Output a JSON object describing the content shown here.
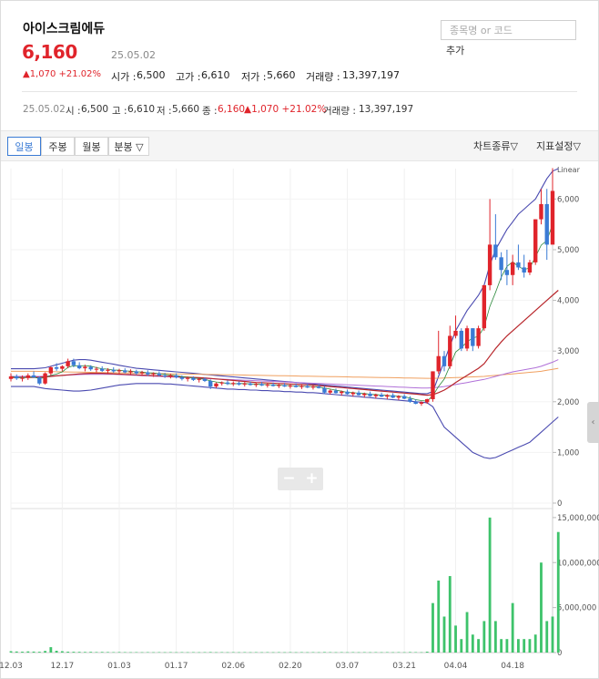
{
  "header": {
    "title": "아이스크림에듀",
    "price": "6,160",
    "date": "25.05.02",
    "change": "▲1,070 +21.02%",
    "open_label": "시가 :",
    "open": "6,500",
    "high_label": "고가 :",
    "high": "6,610",
    "low_label": "저가 :",
    "low": "5,660",
    "vol_label": "거래량 :",
    "volume": "13,397,197",
    "search_placeholder": "종목명 or 코드",
    "add_label": "추가"
  },
  "summary": {
    "date": "25.05.02",
    "open_label": "시 :",
    "open": "6,500",
    "high_label": "고 :",
    "high": "6,610",
    "low_label": "저 :",
    "low": "5,660",
    "close_label": "종 :",
    "close": "6,160",
    "change": "▲1,070 +21.02%",
    "vol_label": "거래량 :",
    "volume": "13,397,197"
  },
  "toolbar": {
    "tabs": [
      "일봉",
      "주봉",
      "월봉",
      "분봉 ▽"
    ],
    "chart_type": "차트종류▽",
    "indicator": "지표설정▽"
  },
  "colors": {
    "up": "#e0242b",
    "down": "#3a7bd5",
    "volume": "#3ec36b",
    "bollinger": "#4a4ab0",
    "ma20": "#b8262b",
    "ma60": "#b070d8",
    "ma120": "#f0a060",
    "ma5": "#2c8a3c"
  },
  "chart_data": {
    "type": "candlestick",
    "scale_label": "Linear",
    "x_ticks": [
      "12.03",
      "12.17",
      "01.03",
      "01.17",
      "02.06",
      "02.20",
      "03.07",
      "03.21",
      "04.04",
      "04.18"
    ],
    "y_ticks": [
      0,
      1000,
      2000,
      3000,
      4000,
      5000,
      6000
    ],
    "y_range": [
      0,
      6600
    ],
    "volume_ticks": [
      0,
      5000000,
      10000000,
      15000000
    ],
    "volume_tick_labels": [
      "0",
      "5,000,000",
      "10,000,000",
      "15,000,000"
    ],
    "volume_range": [
      0,
      16000000
    ],
    "candles": [
      [
        2450,
        2560,
        2400,
        2500
      ],
      [
        2500,
        2540,
        2430,
        2460
      ],
      [
        2460,
        2520,
        2400,
        2470
      ],
      [
        2470,
        2560,
        2430,
        2520
      ],
      [
        2520,
        2600,
        2470,
        2480
      ],
      [
        2480,
        2500,
        2330,
        2360
      ],
      [
        2360,
        2580,
        2340,
        2560
      ],
      [
        2560,
        2700,
        2520,
        2680
      ],
      [
        2680,
        2760,
        2610,
        2650
      ],
      [
        2650,
        2720,
        2600,
        2700
      ],
      [
        2700,
        2850,
        2660,
        2800
      ],
      [
        2800,
        2850,
        2680,
        2720
      ],
      [
        2720,
        2780,
        2640,
        2660
      ],
      [
        2660,
        2730,
        2600,
        2690
      ],
      [
        2690,
        2720,
        2610,
        2640
      ],
      [
        2640,
        2690,
        2580,
        2650
      ],
      [
        2650,
        2700,
        2590,
        2610
      ],
      [
        2610,
        2660,
        2560,
        2630
      ],
      [
        2630,
        2680,
        2570,
        2600
      ],
      [
        2600,
        2650,
        2550,
        2620
      ],
      [
        2620,
        2660,
        2560,
        2580
      ],
      [
        2580,
        2640,
        2540,
        2600
      ],
      [
        2600,
        2630,
        2530,
        2560
      ],
      [
        2560,
        2610,
        2510,
        2580
      ],
      [
        2580,
        2620,
        2510,
        2540
      ],
      [
        2540,
        2580,
        2490,
        2560
      ],
      [
        2560,
        2600,
        2500,
        2520
      ],
      [
        2520,
        2570,
        2470,
        2500
      ],
      [
        2500,
        2550,
        2460,
        2520
      ],
      [
        2520,
        2560,
        2460,
        2480
      ],
      [
        2480,
        2520,
        2420,
        2450
      ],
      [
        2450,
        2500,
        2400,
        2470
      ],
      [
        2470,
        2500,
        2410,
        2430
      ],
      [
        2430,
        2470,
        2380,
        2450
      ],
      [
        2450,
        2480,
        2390,
        2410
      ],
      [
        2410,
        2440,
        2250,
        2300
      ],
      [
        2300,
        2380,
        2270,
        2360
      ],
      [
        2360,
        2400,
        2320,
        2380
      ],
      [
        2380,
        2420,
        2330,
        2350
      ],
      [
        2350,
        2400,
        2310,
        2370
      ],
      [
        2370,
        2400,
        2320,
        2340
      ],
      [
        2340,
        2390,
        2300,
        2360
      ],
      [
        2360,
        2400,
        2320,
        2330
      ],
      [
        2330,
        2380,
        2290,
        2350
      ],
      [
        2350,
        2390,
        2310,
        2320
      ],
      [
        2320,
        2370,
        2280,
        2340
      ],
      [
        2340,
        2380,
        2300,
        2310
      ],
      [
        2310,
        2360,
        2270,
        2330
      ],
      [
        2330,
        2370,
        2290,
        2300
      ],
      [
        2300,
        2350,
        2260,
        2320
      ],
      [
        2320,
        2360,
        2280,
        2290
      ],
      [
        2290,
        2340,
        2250,
        2310
      ],
      [
        2310,
        2350,
        2270,
        2280
      ],
      [
        2280,
        2320,
        2240,
        2300
      ],
      [
        2300,
        2340,
        2260,
        2270
      ],
      [
        2270,
        2310,
        2150,
        2180
      ],
      [
        2180,
        2250,
        2140,
        2220
      ],
      [
        2220,
        2260,
        2160,
        2170
      ],
      [
        2170,
        2220,
        2120,
        2200
      ],
      [
        2200,
        2240,
        2140,
        2150
      ],
      [
        2150,
        2200,
        2100,
        2180
      ],
      [
        2180,
        2220,
        2120,
        2130
      ],
      [
        2130,
        2180,
        2080,
        2160
      ],
      [
        2160,
        2200,
        2100,
        2110
      ],
      [
        2110,
        2160,
        2060,
        2140
      ],
      [
        2140,
        2180,
        2090,
        2100
      ],
      [
        2100,
        2150,
        2050,
        2130
      ],
      [
        2130,
        2170,
        2070,
        2080
      ],
      [
        2080,
        2130,
        2030,
        2110
      ],
      [
        2110,
        2150,
        2050,
        2060
      ],
      [
        2060,
        2110,
        1980,
        2000
      ],
      [
        2000,
        2050,
        1950,
        1960
      ],
      [
        1960,
        2010,
        1920,
        1990
      ],
      [
        1990,
        2060,
        1960,
        2050
      ],
      [
        2050,
        2600,
        2000,
        2600
      ],
      [
        2600,
        3400,
        2550,
        2900
      ],
      [
        2900,
        3000,
        2600,
        2700
      ],
      [
        2700,
        3500,
        2650,
        3300
      ],
      [
        3300,
        3700,
        3250,
        3400
      ],
      [
        3400,
        3450,
        3000,
        3050
      ],
      [
        3050,
        3500,
        3000,
        3450
      ],
      [
        3450,
        3450,
        3000,
        3100
      ],
      [
        3100,
        3500,
        3050,
        3450
      ],
      [
        3450,
        4300,
        3400,
        4300
      ],
      [
        4300,
        6000,
        4200,
        5100
      ],
      [
        5100,
        5700,
        4800,
        4850
      ],
      [
        4850,
        4950,
        4400,
        4600
      ],
      [
        4600,
        5000,
        4300,
        4500
      ],
      [
        4500,
        4900,
        4300,
        4750
      ],
      [
        4750,
        5100,
        4600,
        4650
      ],
      [
        4650,
        4900,
        4450,
        4550
      ],
      [
        4550,
        4800,
        4500,
        4750
      ],
      [
        4750,
        5600,
        4700,
        5600
      ],
      [
        5600,
        6200,
        5500,
        5900
      ],
      [
        5900,
        6200,
        4800,
        5100
      ],
      [
        5100,
        6610,
        5660,
        6160
      ]
    ],
    "volumes": [
      150000,
      120000,
      100000,
      130000,
      110000,
      90000,
      180000,
      600000,
      200000,
      150000,
      100000,
      90000,
      80000,
      70000,
      80000,
      60000,
      70000,
      60000,
      50000,
      60000,
      50000,
      40000,
      50000,
      40000,
      50000,
      40000,
      50000,
      40000,
      50000,
      40000,
      50000,
      40000,
      50000,
      40000,
      50000,
      60000,
      40000,
      50000,
      40000,
      50000,
      40000,
      50000,
      40000,
      50000,
      40000,
      50000,
      40000,
      50000,
      40000,
      50000,
      40000,
      50000,
      40000,
      50000,
      40000,
      60000,
      50000,
      40000,
      50000,
      40000,
      50000,
      40000,
      50000,
      40000,
      50000,
      40000,
      50000,
      40000,
      50000,
      40000,
      60000,
      50000,
      40000,
      100000,
      5500000,
      8000000,
      4000000,
      8500000,
      3000000,
      1500000,
      4500000,
      2000000,
      1500000,
      3500000,
      15000000,
      3500000,
      1500000,
      1500000,
      5500000,
      1500000,
      1500000,
      1500000,
      2000000,
      10000000,
      3500000,
      4000000,
      13397197
    ],
    "series_lines": {
      "bollinger_upper": [
        2650,
        2650,
        2650,
        2650,
        2650,
        2660,
        2670,
        2700,
        2730,
        2760,
        2790,
        2820,
        2830,
        2830,
        2820,
        2800,
        2780,
        2760,
        2740,
        2720,
        2700,
        2680,
        2660,
        2650,
        2640,
        2630,
        2620,
        2610,
        2600,
        2590,
        2580,
        2570,
        2560,
        2550,
        2540,
        2530,
        2520,
        2510,
        2500,
        2490,
        2480,
        2470,
        2460,
        2450,
        2440,
        2430,
        2420,
        2410,
        2400,
        2390,
        2380,
        2370,
        2360,
        2350,
        2340,
        2330,
        2320,
        2310,
        2300,
        2290,
        2280,
        2270,
        2260,
        2250,
        2240,
        2230,
        2220,
        2210,
        2200,
        2190,
        2180,
        2170,
        2160,
        2160,
        2200,
        2500,
        2800,
        3100,
        3400,
        3600,
        3800,
        3950,
        4100,
        4300,
        4700,
        5000,
        5200,
        5400,
        5550,
        5700,
        5800,
        5900,
        6000,
        6200,
        6400,
        6550,
        6600
      ],
      "bollinger_lower": [
        2300,
        2300,
        2300,
        2300,
        2300,
        2280,
        2260,
        2250,
        2240,
        2230,
        2220,
        2210,
        2210,
        2220,
        2230,
        2250,
        2270,
        2290,
        2310,
        2330,
        2340,
        2350,
        2360,
        2360,
        2360,
        2360,
        2360,
        2350,
        2350,
        2340,
        2330,
        2320,
        2310,
        2300,
        2290,
        2280,
        2270,
        2260,
        2250,
        2250,
        2240,
        2240,
        2230,
        2230,
        2220,
        2220,
        2210,
        2210,
        2200,
        2200,
        2190,
        2190,
        2180,
        2180,
        2170,
        2160,
        2150,
        2140,
        2130,
        2120,
        2110,
        2100,
        2090,
        2080,
        2070,
        2060,
        2050,
        2040,
        2030,
        2020,
        2010,
        2000,
        1990,
        1980,
        1900,
        1700,
        1500,
        1400,
        1300,
        1200,
        1100,
        1000,
        950,
        900,
        880,
        900,
        950,
        1000,
        1050,
        1100,
        1150,
        1200,
        1300,
        1400,
        1500,
        1600,
        1700
      ],
      "ma20": [
        2480,
        2480,
        2480,
        2480,
        2480,
        2485,
        2490,
        2500,
        2510,
        2520,
        2530,
        2540,
        2550,
        2555,
        2560,
        2560,
        2560,
        2555,
        2550,
        2545,
        2540,
        2535,
        2530,
        2525,
        2520,
        2515,
        2510,
        2505,
        2500,
        2495,
        2490,
        2485,
        2480,
        2475,
        2470,
        2460,
        2450,
        2440,
        2430,
        2420,
        2410,
        2400,
        2390,
        2380,
        2375,
        2370,
        2365,
        2360,
        2355,
        2350,
        2345,
        2340,
        2335,
        2330,
        2320,
        2310,
        2300,
        2290,
        2280,
        2270,
        2260,
        2250,
        2240,
        2230,
        2220,
        2210,
        2200,
        2190,
        2180,
        2170,
        2160,
        2150,
        2140,
        2130,
        2140,
        2180,
        2230,
        2300,
        2380,
        2450,
        2520,
        2590,
        2660,
        2750,
        2900,
        3050,
        3180,
        3300,
        3400,
        3500,
        3600,
        3700,
        3800,
        3900,
        4000,
        4100,
        4200
      ],
      "ma60": [
        2500,
        2500,
        2500,
        2500,
        2500,
        2500,
        2505,
        2510,
        2515,
        2520,
        2525,
        2530,
        2535,
        2540,
        2540,
        2540,
        2540,
        2540,
        2540,
        2535,
        2530,
        2525,
        2520,
        2515,
        2510,
        2505,
        2500,
        2495,
        2490,
        2485,
        2480,
        2475,
        2470,
        2465,
        2460,
        2455,
        2450,
        2445,
        2440,
        2435,
        2430,
        2425,
        2420,
        2415,
        2410,
        2405,
        2400,
        2395,
        2390,
        2385,
        2380,
        2375,
        2370,
        2365,
        2360,
        2355,
        2350,
        2345,
        2340,
        2335,
        2330,
        2325,
        2320,
        2315,
        2310,
        2305,
        2300,
        2295,
        2290,
        2285,
        2280,
        2275,
        2270,
        2270,
        2275,
        2285,
        2300,
        2320,
        2340,
        2360,
        2380,
        2400,
        2420,
        2440,
        2470,
        2500,
        2530,
        2560,
        2590,
        2610,
        2630,
        2650,
        2670,
        2700,
        2740,
        2780,
        2830
      ],
      "ma120": [
        2600,
        2600,
        2600,
        2600,
        2600,
        2598,
        2596,
        2594,
        2592,
        2590,
        2588,
        2586,
        2584,
        2582,
        2580,
        2578,
        2576,
        2574,
        2572,
        2570,
        2568,
        2566,
        2564,
        2562,
        2560,
        2558,
        2556,
        2554,
        2552,
        2550,
        2548,
        2546,
        2544,
        2542,
        2540,
        2538,
        2536,
        2534,
        2532,
        2530,
        2528,
        2526,
        2524,
        2522,
        2520,
        2518,
        2516,
        2514,
        2512,
        2510,
        2508,
        2506,
        2504,
        2502,
        2500,
        2498,
        2496,
        2494,
        2492,
        2490,
        2488,
        2486,
        2484,
        2482,
        2480,
        2478,
        2476,
        2474,
        2472,
        2470,
        2468,
        2466,
        2464,
        2462,
        2462,
        2464,
        2468,
        2472,
        2476,
        2480,
        2485,
        2490,
        2495,
        2500,
        2510,
        2520,
        2530,
        2540,
        2550,
        2560,
        2570,
        2580,
        2590,
        2600,
        2620,
        2640,
        2660
      ]
    }
  }
}
